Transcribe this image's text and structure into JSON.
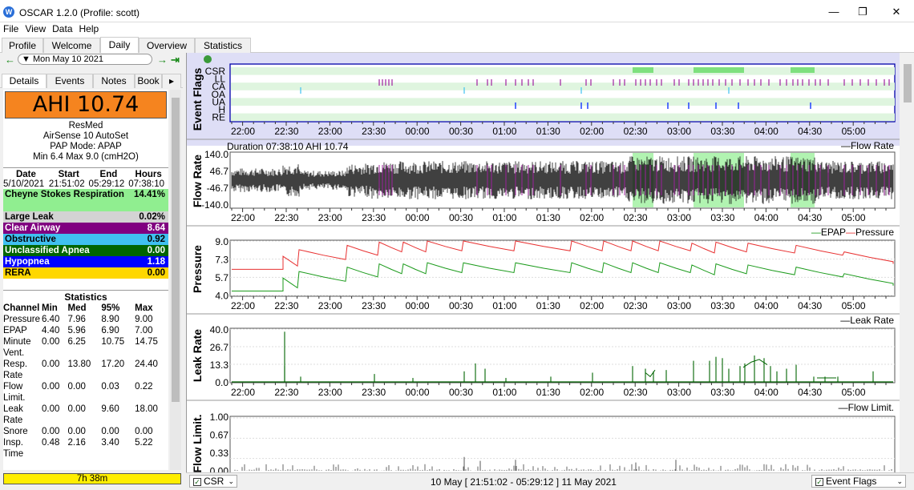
{
  "window": {
    "title": "OSCAR 1.2.0 (Profile: scott)",
    "minimize": "—",
    "maximize": "❐",
    "close": "✕"
  },
  "menu": [
    "File",
    "View",
    "Data",
    "Help"
  ],
  "main_tabs": [
    "Profile",
    "Welcome",
    "Daily",
    "Overview",
    "Statistics"
  ],
  "date_nav": {
    "date": "Mon May 10 2021",
    "prev": "←",
    "next": "→",
    "last": "⇥"
  },
  "side_tabs": [
    "Details",
    "Events",
    "Notes",
    "Book",
    "▸"
  ],
  "summary": {
    "ahi": "AHI 10.74",
    "brand": "ResMed",
    "model": "AirSense 10 AutoSet",
    "mode": "PAP Mode: APAP",
    "pressure": "Min 6.4 Max 9.0 (cmH2O)"
  },
  "session": {
    "headers": [
      "Date",
      "Start",
      "End",
      "Hours"
    ],
    "date": "5/10/2021",
    "start": "21:51:02",
    "end": "05:29:12",
    "hours": "07:38:10"
  },
  "events": [
    {
      "label": "Cheyne Stokes Respiration",
      "value": "14.41%",
      "bg": "#90ee90",
      "fg": "#000"
    },
    {
      "label": "Large Leak",
      "value": "0.02%",
      "bg": "#d3d3d3",
      "fg": "#000"
    },
    {
      "label": "Clear Airway",
      "value": "8.64",
      "bg": "#800080",
      "fg": "#fff"
    },
    {
      "label": "Obstructive",
      "value": "0.92",
      "bg": "#40c0f0",
      "fg": "#000"
    },
    {
      "label": "Unclassified Apnea",
      "value": "0.00",
      "bg": "#006400",
      "fg": "#fff"
    },
    {
      "label": "Hypopnea",
      "value": "1.18",
      "bg": "#0000ff",
      "fg": "#fff"
    },
    {
      "label": "RERA",
      "value": "0.00",
      "bg": "#ffd700",
      "fg": "#000"
    }
  ],
  "statistics": {
    "title": "Statistics",
    "headers": [
      "Channel",
      "Min",
      "Med",
      "95%",
      "Max"
    ],
    "rows": [
      [
        "Pressure",
        "6.40",
        "7.96",
        "8.90",
        "9.00"
      ],
      [
        "EPAP",
        "4.40",
        "5.96",
        "6.90",
        "7.00"
      ],
      [
        "Minute Vent.",
        "0.00",
        "6.25",
        "10.75",
        "14.75"
      ],
      [
        "Resp. Rate",
        "0.00",
        "13.80",
        "17.20",
        "24.40"
      ],
      [
        "Flow Limit.",
        "0.00",
        "0.00",
        "0.03",
        "0.22"
      ],
      [
        "Leak Rate",
        "0.00",
        "0.00",
        "9.60",
        "18.00"
      ],
      [
        "Snore",
        "0.00",
        "0.00",
        "0.00",
        "0.00"
      ],
      [
        "Insp. Time",
        "0.48",
        "2.16",
        "3.40",
        "5.22"
      ]
    ]
  },
  "duration": "7h 38m",
  "time_ticks": [
    "22:00",
    "22:30",
    "23:00",
    "23:30",
    "00:00",
    "00:30",
    "01:00",
    "01:30",
    "02:00",
    "02:30",
    "03:00",
    "03:30",
    "04:00",
    "04:30",
    "05:00"
  ],
  "graphs": {
    "event_flags": {
      "title": "Event Flags",
      "rows": [
        "CSR",
        "LL",
        "CA",
        "OA",
        "UA",
        "H",
        "RE"
      ]
    },
    "flow": {
      "title": "Flow Rate",
      "info": "Duration 07:38:10 AHI 10.74",
      "legend": "Flow Rate",
      "ticks": [
        "140.0",
        "46.7",
        "-46.7",
        "-140.0"
      ]
    },
    "pressure": {
      "title": "Pressure",
      "legend_epap": "EPAP",
      "legend_pressure": "Pressure",
      "ticks": [
        "9.0",
        "7.3",
        "5.7",
        "4.0"
      ]
    },
    "leak": {
      "title": "Leak Rate",
      "legend": "Leak Rate",
      "ticks": [
        "40.0",
        "26.7",
        "13.3",
        "0.0"
      ]
    },
    "flowlimit": {
      "title": "Flow Limit.",
      "legend": "Flow Limit.",
      "ticks": [
        "1.00",
        "0.67",
        "0.33",
        "0.00"
      ]
    }
  },
  "statusbar": {
    "left_combo": "CSR",
    "range": "10 May [ 21:51:02 - 05:29:12 ] 11 May 2021",
    "right_combo": "Event Flags"
  },
  "colors": {
    "csr": "#90ee90",
    "ca": "#800080",
    "oa": "#40c0f0",
    "h": "#0000ff",
    "pressure": "#e83030",
    "epap": "#1a9a1a",
    "leak": "#006400",
    "ahi": "#f5841f"
  }
}
